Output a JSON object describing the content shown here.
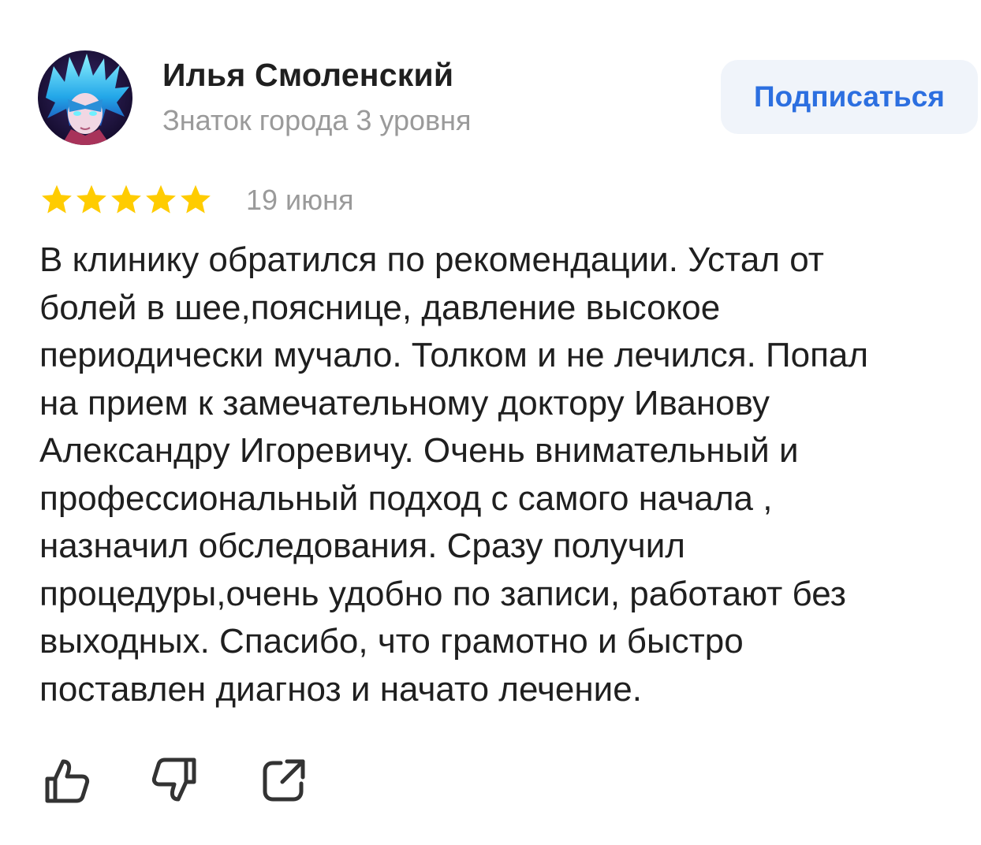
{
  "author": {
    "name": "Илья Смоленский",
    "level": "Знаток города 3 уровня",
    "avatar_icon": "anime-avatar"
  },
  "subscribe": {
    "label": "Подписаться"
  },
  "review": {
    "rating": 5,
    "rating_max": 5,
    "date": "19 июня",
    "lines": [
      "В клинику обратился по рекомендации. Устал от",
      "болей в шее,пояснице, давление высокое",
      "периодически мучало. Толком и не лечился. Попал",
      "на прием к замечательному доктору Иванову",
      "Александру Игоревичу. Очень внимательный и",
      "профессиональный подход с самого начала ,",
      "назначил обследования. Сразу получил",
      "процедуры,очень удобно по записи, работают без",
      "выходных. Спасибо, что грамотно и быстро",
      "поставлен диагноз и начато лечение."
    ]
  },
  "actions": {
    "like_icon": "thumbs-up-icon",
    "dislike_icon": "thumbs-down-icon",
    "share_icon": "share-icon"
  },
  "colors": {
    "star": "#FFCC00",
    "accent": "#2C6FE0",
    "button_bg": "#F0F4FA",
    "secondary_text": "#9A9A9A",
    "icon": "#333333"
  }
}
